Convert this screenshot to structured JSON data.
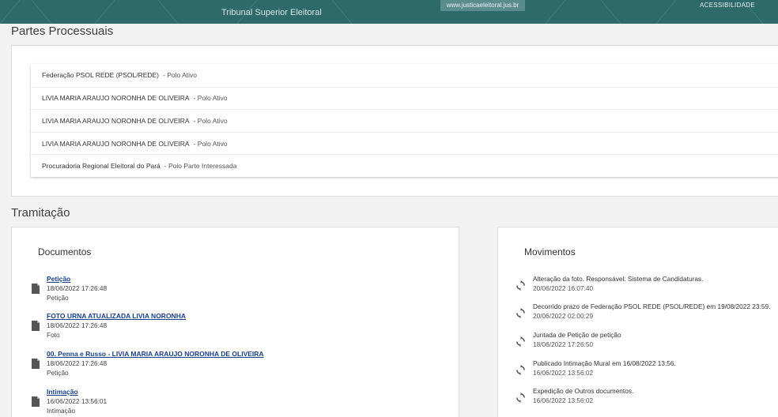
{
  "topbar": {
    "org": "Tribunal Superior Eleitoral",
    "url": "www.justicaeleitoral.jus.br",
    "accessibility": "ACESSIBILIDADE"
  },
  "partes": {
    "title": "Partes Processuais",
    "items": [
      {
        "name": "Federação PSOL REDE (PSOL/REDE)",
        "polo": "- Polo Ativo"
      },
      {
        "name": "LIVIA MARIA ARAUJO NORONHA DE OLIVEIRA",
        "polo": "- Polo Ativo"
      },
      {
        "name": "LIVIA MARIA ARAUJO NORONHA DE OLIVEIRA",
        "polo": "- Polo Ativo"
      },
      {
        "name": "LIVIA MARIA ARAUJO NORONHA DE OLIVEIRA",
        "polo": "- Polo Ativo"
      },
      {
        "name": "Procuradoria Regional Eleitoral do Pará",
        "polo": "- Polo Parte Interessada"
      }
    ]
  },
  "tramitacao": {
    "title": "Tramitação",
    "documentos": {
      "title": "Documentos",
      "items": [
        {
          "title": "Petição",
          "date": "18/06/2022 17:26:48",
          "type": "Petição",
          "icon": "file-icon"
        },
        {
          "title": "FOTO URNA ATUALIZADA LIVIA NORONHA",
          "date": "18/06/2022 17:26:48",
          "type": "Foto",
          "icon": "file-icon"
        },
        {
          "title": "00. Penna e Russo - LIVIA MARIA ARAUJO NORONHA DE OLIVEIRA",
          "date": "18/06/2022 17:26:48",
          "type": "Petição",
          "icon": "file-icon"
        },
        {
          "title": "Intimação",
          "date": "16/06/2022 13:56:01",
          "type": "Intimação",
          "icon": "file-icon"
        }
      ]
    },
    "movimentos": {
      "title": "Movimentos",
      "items": [
        {
          "text": "Alteração da foto. Responsável: Sistema de Candidaturas.",
          "date": "20/06/2022 16:07:40",
          "icon": "sync-icon"
        },
        {
          "text": "Decorrido prazo de Federação PSOL REDE (PSOL/REDE) em 19/08/2022 23:59.",
          "date": "20/06/2022 02:00:29",
          "icon": "sync-icon"
        },
        {
          "text": "Juntada de Petição de petição",
          "date": "18/06/2022 17:26:50",
          "icon": "sync-icon"
        },
        {
          "text": "Publicado Intimação Mural em 16/08/2022 13:56.",
          "date": "16/06/2022 13:56:02",
          "icon": "sync-icon"
        },
        {
          "text": "Expedição de Outros documentos.",
          "date": "16/06/2022 13:56:02",
          "icon": "sync-icon"
        }
      ]
    }
  }
}
